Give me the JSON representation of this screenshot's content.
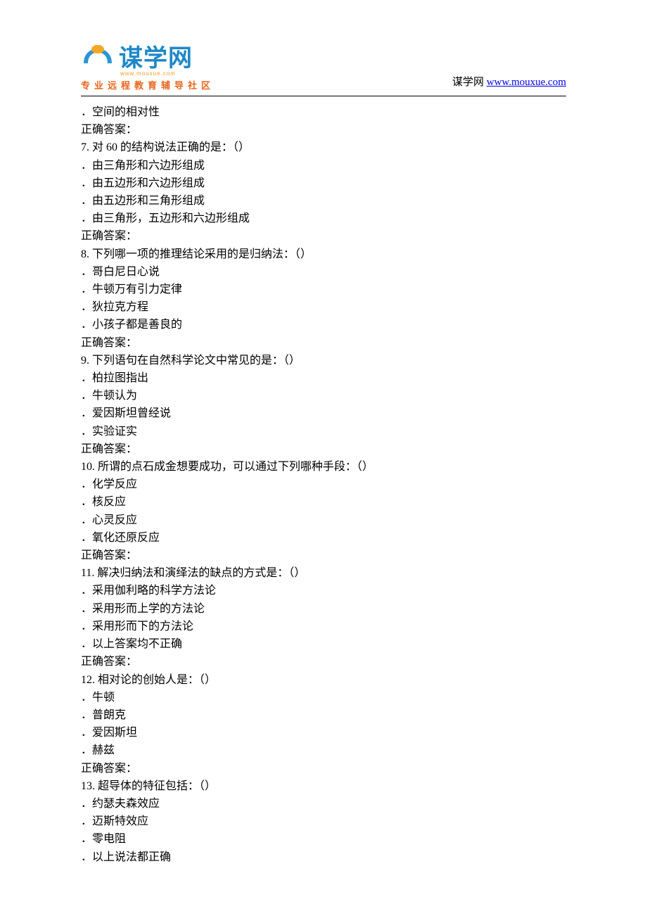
{
  "header": {
    "logo_text": "谋学网",
    "logo_sub": "www.mouxue.com",
    "tagline": "专业远程教育辅导社区",
    "right_label": "谋学网 ",
    "right_url_text": "www.mouxue.com"
  },
  "lines": [
    "．空间的相对性",
    "正确答案：",
    "7.   对 60 的结构说法正确的是：（）",
    "．由三角形和六边形组成",
    "．由五边形和六边形组成",
    "．由五边形和三角形组成",
    "．由三角形，五边形和六边形组成",
    "正确答案：",
    "8.   下列哪一项的推理结论采用的是归纳法：（）",
    "．哥白尼日心说",
    "．牛顿万有引力定律",
    "．狄拉克方程",
    "．小孩子都是善良的",
    "正确答案：",
    "9.   下列语句在自然科学论文中常见的是：（）",
    "．柏拉图指出",
    "．牛顿认为",
    "．爱因斯坦曾经说",
    "．实验证实",
    "正确答案：",
    "10.   所谓的点石成金想要成功，可以通过下列哪种手段：（）",
    "．化学反应",
    "．核反应",
    "．心灵反应",
    "．氧化还原反应",
    "正确答案：",
    "11.   解决归纳法和演绎法的缺点的方式是：（）",
    "．采用伽利略的科学方法论",
    "．采用形而上学的方法论",
    "．采用形而下的方法论",
    "．以上答案均不正确",
    "正确答案：",
    "12.   相对论的创始人是：（）",
    "．牛顿",
    "．普朗克",
    "．爱因斯坦",
    "．赫兹",
    "正确答案：",
    "13.   超导体的特征包括：（）",
    "．约瑟夫森效应",
    "．迈斯特效应",
    "．零电阻",
    "．以上说法都正确"
  ]
}
